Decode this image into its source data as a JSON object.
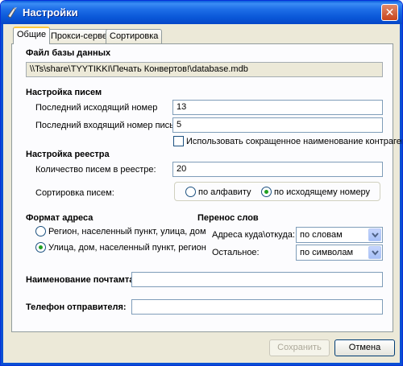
{
  "window": {
    "title": "Настройки",
    "close_label": "✕"
  },
  "tabs": [
    {
      "label": "Общие",
      "active": true
    },
    {
      "label": "Прокси-сервер",
      "active": false
    },
    {
      "label": "Сортировка",
      "active": false
    }
  ],
  "database": {
    "heading": "Файл базы данных",
    "path": "\\\\Ts\\share\\TYYTIKKI\\Печать Конвертов!\\database.mdb"
  },
  "letters": {
    "heading": "Настройка писем",
    "last_outgoing_label": "Последний исходящий номер",
    "last_outgoing_value": "13",
    "last_incoming_label": "Последний входящий номер письма:",
    "last_incoming_value": "5",
    "short_name_checkbox_label": "Использовать сокращенное наименование контрагента",
    "short_name_checked": false
  },
  "registry": {
    "heading": "Настройка реестра",
    "count_label": "Количество писем в реестре:",
    "count_value": "20",
    "sort_label": "Сортировка писем:",
    "sort_alphabet": "по алфавиту",
    "sort_outgoing": "по исходящему номеру",
    "sort_selected": "outgoing"
  },
  "address_format": {
    "heading": "Формат адреса",
    "option_region_first": "Регион, населенный пункт, улица, дом",
    "option_street_first": "Улица, дом, населенный пункт, регион",
    "selected": "street_first"
  },
  "word_wrap": {
    "heading": "Перенос слов",
    "address_label": "Адреса куда\\откуда:",
    "address_value": "по словам",
    "other_label": "Остальное:",
    "other_value": "по символам"
  },
  "post_office": {
    "label": "Наименование почтамта:",
    "value": ""
  },
  "sender_phone": {
    "label": "Телефон отправителя:",
    "value": ""
  },
  "footer": {
    "save_label": "Сохранить",
    "save_enabled": false,
    "cancel_label": "Отмена"
  },
  "colors": {
    "titlebar": "#0a58d8",
    "dialog_bg": "#ece9d8",
    "tab_highlight": "#ffc83c",
    "radio_dot": "#21a121",
    "field_border": "#7f9db9"
  },
  "icons": {
    "app": "app-icon",
    "close": "close-icon",
    "dropdown": "chevron-down-icon"
  }
}
